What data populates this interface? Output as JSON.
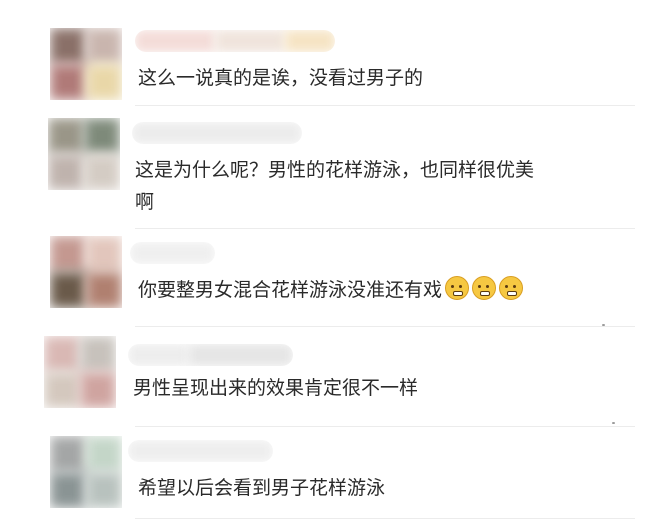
{
  "comments": [
    {
      "text": "这么一说真的是诶，没看过男子的"
    },
    {
      "text_line1": "这是为什么呢？男性的花样游泳，也同样很优美",
      "text_line2": "啊"
    },
    {
      "text": "你要整男女混合花样游泳没准还有戏",
      "emoji_icons": [
        "doge-icon",
        "doge-icon",
        "doge-icon"
      ]
    },
    {
      "text": "男性呈现出来的效果肯定很不一样"
    },
    {
      "text": "希望以后会看到男子花样游泳"
    }
  ]
}
